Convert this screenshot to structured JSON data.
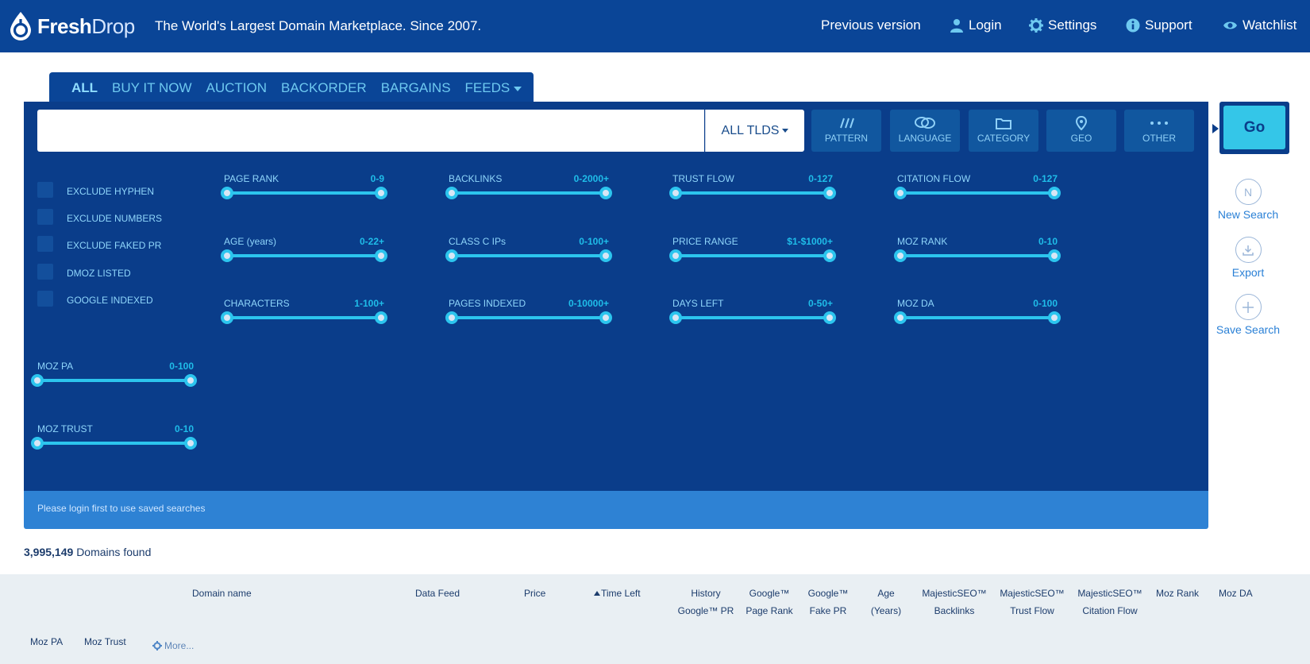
{
  "header": {
    "logo_bold": "Fresh",
    "logo_light": "Drop",
    "tagline": "The World's Largest Domain Marketplace. Since 2007.",
    "nav": {
      "previous_version": "Previous version",
      "login": "Login",
      "settings": "Settings",
      "support": "Support",
      "watchlist": "Watchlist"
    }
  },
  "tabs": [
    {
      "label": "ALL"
    },
    {
      "label": "BUY IT NOW"
    },
    {
      "label": "AUCTION"
    },
    {
      "label": "BACKORDER"
    },
    {
      "label": "BARGAINS"
    },
    {
      "label": "FEEDS"
    }
  ],
  "search": {
    "value": "",
    "tld_label": "ALL TLDS",
    "go_label": "Go"
  },
  "filter_buttons": {
    "pattern": "PATTERN",
    "language": "LANGUAGE",
    "category": "CATEGORY",
    "geo": "GEO",
    "other": "OTHER"
  },
  "checkboxes": [
    {
      "label": "EXCLUDE HYPHEN"
    },
    {
      "label": "EXCLUDE NUMBERS"
    },
    {
      "label": "EXCLUDE FAKED PR"
    },
    {
      "label": "DMOZ LISTED"
    },
    {
      "label": "GOOGLE INDEXED"
    }
  ],
  "sliders": {
    "page_rank": {
      "label": "PAGE RANK",
      "range": "0-9"
    },
    "backlinks": {
      "label": "BACKLINKS",
      "range": "0-2000+"
    },
    "trust_flow": {
      "label": "TRUST FLOW",
      "range": "0-127"
    },
    "citation_flow": {
      "label": "CITATION FLOW",
      "range": "0-127"
    },
    "age": {
      "label": "AGE (years)",
      "range": "0-22+"
    },
    "class_c_ips": {
      "label": "CLASS C IPs",
      "range": "0-100+"
    },
    "price_range": {
      "label": "PRICE RANGE",
      "range": "$1-$1000+"
    },
    "moz_rank": {
      "label": "MOZ RANK",
      "range": "0-10"
    },
    "characters": {
      "label": "CHARACTERS",
      "range": "1-100+"
    },
    "pages_indexed": {
      "label": "PAGES INDEXED",
      "range": "0-10000+"
    },
    "days_left": {
      "label": "DAYS LEFT",
      "range": "0-50+"
    },
    "moz_da": {
      "label": "MOZ DA",
      "range": "0-100"
    },
    "moz_pa": {
      "label": "MOZ PA",
      "range": "0-100"
    },
    "moz_trust": {
      "label": "MOZ TRUST",
      "range": "0-10"
    }
  },
  "saved_search_note": "Please login first to use saved searches",
  "side_actions": {
    "new_search": "New Search",
    "new_search_glyph": "N",
    "export": "Export",
    "save_search": "Save Search"
  },
  "results": {
    "count": "3,995,149",
    "count_suffix": "Domains found",
    "columns": {
      "domain_name": "Domain name",
      "data_feed": "Data Feed",
      "price": "Price",
      "time_left": "Time Left",
      "history_1": "History",
      "history_2": "Google™ PR",
      "google_pr_1": "Google™",
      "google_pr_2": "Page Rank",
      "fake_pr_1": "Google™",
      "fake_pr_2": "Fake PR",
      "age_1": "Age",
      "age_2": "(Years)",
      "backlinks_1": "MajesticSEO™",
      "backlinks_2": "Backlinks",
      "trust_flow_1": "MajesticSEO™",
      "trust_flow_2": "Trust Flow",
      "citation_flow_1": "MajesticSEO™",
      "citation_flow_2": "Citation Flow",
      "moz_rank": "Moz Rank",
      "moz_da": "Moz DA",
      "moz_pa": "Moz PA",
      "moz_trust": "Moz Trust"
    },
    "more_label": "More..."
  }
}
